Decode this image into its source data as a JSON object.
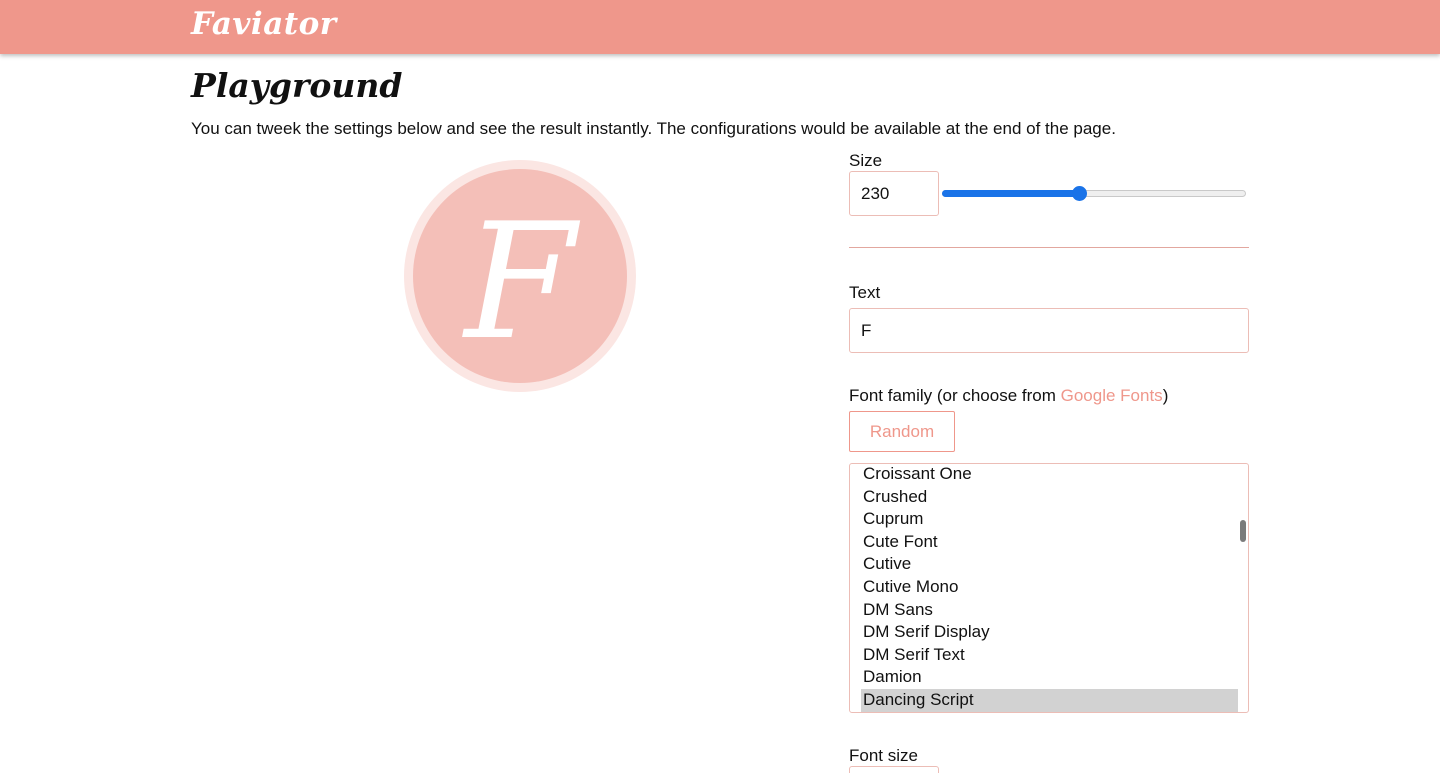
{
  "header": {
    "brand": "Faviator"
  },
  "page": {
    "title": "Playground",
    "intro": "You can tweek the settings below and see the result instantly. The configurations would be available at the end of the page."
  },
  "preview": {
    "text": "F"
  },
  "settings": {
    "size": {
      "label": "Size",
      "value": "230",
      "slider_fraction": 0.45
    },
    "text": {
      "label": "Text",
      "value": "F"
    },
    "font_family": {
      "label_prefix": "Font family (or choose from ",
      "link_text": "Google Fonts",
      "label_suffix": ")",
      "random_label": "Random",
      "options": [
        "Croissant One",
        "Crushed",
        "Cuprum",
        "Cute Font",
        "Cutive",
        "Cutive Mono",
        "DM Sans",
        "DM Serif Display",
        "DM Serif Text",
        "Damion",
        "Dancing Script"
      ],
      "selected": "Dancing Script"
    },
    "font_size": {
      "label": "Font size"
    }
  },
  "colors": {
    "accent": "#ef978b",
    "preview_fill": "#f4bfb8",
    "preview_ring": "#fbe6e3",
    "slider": "#1a73e8"
  }
}
